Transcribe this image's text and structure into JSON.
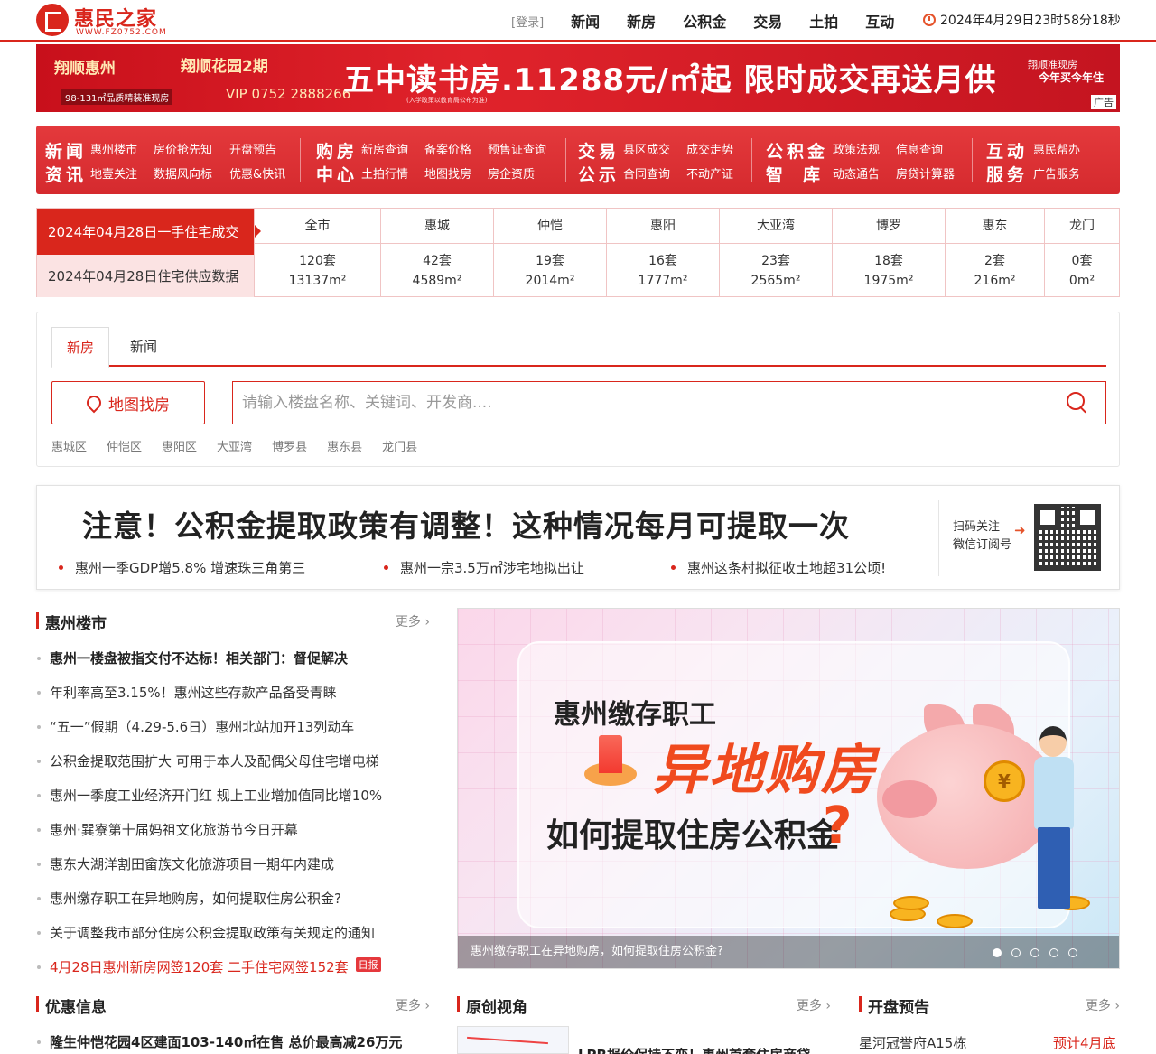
{
  "header": {
    "logo_name": "惠民之家",
    "logo_url": "WWW.FZ0752.COM",
    "login": "[登录]",
    "nav": [
      "新闻",
      "新房",
      "公积金",
      "交易",
      "土拍",
      "互动"
    ],
    "clock": "2024年4月29日23时58分18秒"
  },
  "banner": {
    "brand1": "翔顺惠州",
    "brand2": "翔顺花园2期",
    "size_note": "98-131㎡品质精装准现房",
    "phone": "VIP 0752 2888266",
    "headline": "五中读书房.11288元/㎡起 限时成交再送月供",
    "fineprint": "(入学政策以教育局公布为准)",
    "side1": "翔顺准现房",
    "side2": "今年买今年住",
    "ad_label": "广告"
  },
  "catnav": [
    {
      "big": [
        "新闻",
        "资讯"
      ],
      "links": [
        [
          "惠州楼市",
          "房价抢先知",
          "开盘预告"
        ],
        [
          "地壹关注",
          "数据风向标",
          "优惠&快讯"
        ]
      ]
    },
    {
      "big": [
        "购房",
        "中心"
      ],
      "links": [
        [
          "新房查询",
          "备案价格",
          "预售证查询"
        ],
        [
          "土拍行情",
          "地图找房",
          "房企资质"
        ]
      ]
    },
    {
      "big": [
        "交易",
        "公示"
      ],
      "links": [
        [
          "县区成交",
          "成交走势"
        ],
        [
          "合同查询",
          "不动产证"
        ]
      ]
    },
    {
      "big": [
        "公积金",
        "智库"
      ],
      "links": [
        [
          "政策法规",
          "信息查询"
        ],
        [
          "动态通告",
          "房贷计算器"
        ]
      ]
    },
    {
      "big": [
        "互动",
        "服务"
      ],
      "links": [
        [
          "惠民帮办"
        ],
        [
          "广告服务"
        ]
      ]
    }
  ],
  "deals": {
    "label_deal": "2024年04月28日一手住宅成交",
    "label_supply": "2024年04月28日住宅供应数据",
    "columns": [
      {
        "name": "全市",
        "units": "120套",
        "area": "13137m²"
      },
      {
        "name": "惠城",
        "units": "42套",
        "area": "4589m²"
      },
      {
        "name": "仲恺",
        "units": "19套",
        "area": "2014m²"
      },
      {
        "name": "惠阳",
        "units": "16套",
        "area": "1777m²"
      },
      {
        "name": "大亚湾",
        "units": "23套",
        "area": "2565m²"
      },
      {
        "name": "博罗",
        "units": "18套",
        "area": "1975m²"
      },
      {
        "name": "惠东",
        "units": "2套",
        "area": "216m²"
      },
      {
        "name": "龙门",
        "units": "0套",
        "area": "0m²"
      }
    ]
  },
  "search": {
    "tabs": [
      "新房",
      "新闻"
    ],
    "map_button": "地图找房",
    "placeholder": "请输入楼盘名称、关键词、开发商....",
    "districts": [
      "惠城区",
      "仲恺区",
      "惠阳区",
      "大亚湾",
      "博罗县",
      "惠东县",
      "龙门县"
    ]
  },
  "headline": {
    "title": "注意！公积金提取政策有调整！这种情况每月可提取一次",
    "subs": [
      "惠州一季GDP增5.8% 增速珠三角第三",
      "惠州一宗3.5万㎡涉宅地拟出让",
      "惠州这条村拟征收土地超31公顷!"
    ],
    "qr_text1": "扫码关注",
    "qr_text2": "微信订阅号"
  },
  "market": {
    "title": "惠州楼市",
    "more": "更多 ›",
    "items": [
      "惠州一楼盘被指交付不达标！相关部门：督促解决",
      "年利率高至3.15%！惠州这些存款产品备受青睐",
      "“五一”假期（4.29-5.6日）惠州北站加开13列动车",
      "公积金提取范围扩大 可用于本人及配偶父母住宅增电梯",
      "惠州一季度工业经济开门红 规上工业增加值同比增10%",
      "惠州·巽寮第十届妈祖文化旅游节今日开幕",
      "惠东大湖洋割田畲族文化旅游项目一期年内建成",
      "惠州缴存职工在异地购房，如何提取住房公积金?",
      "关于调整我市部分住房公积金提取政策有关规定的通知",
      "4月28日惠州新房网签120套 二手住宅网签152套"
    ],
    "badge": "日报"
  },
  "slider": {
    "line1": "惠州缴存职工",
    "line2": "异地购房",
    "line3": "如何提取住房公积金",
    "qmark": "?",
    "coin": "¥",
    "caption": "惠州缴存职工在异地购房，如何提取住房公积金?",
    "dots": 5,
    "active_dot": 0
  },
  "bottom": {
    "promo_title": "优惠信息",
    "promo_item": "隆生仲恺花园4区建面103-140㎡在售 总价最高减26万元",
    "original_title": "原创视角",
    "original_item": "LPR报价保持不变！惠州首套住房商贷",
    "open_title": "开盘预告",
    "open_item": "星河冠誉府A15栋",
    "open_value": "预计4月底",
    "more": "更多 ›"
  }
}
